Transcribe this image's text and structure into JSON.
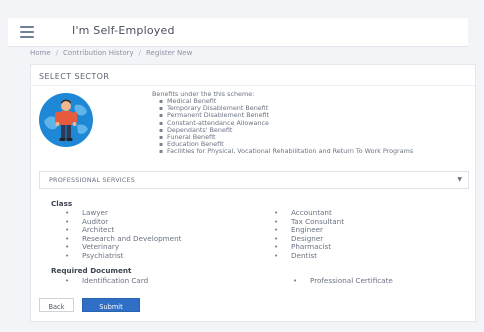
{
  "header": {
    "app_title": "I'm Self-Employed"
  },
  "breadcrumb": {
    "items": [
      "Home",
      "Contribution History",
      "Register New"
    ]
  },
  "card": {
    "title": "SELECT SECTOR",
    "benefits_heading": "Benefits under the this scheme:",
    "benefits": [
      "Medical Benefit",
      "Temporary Disablement Benefit",
      "Permanent Disablement Benefit",
      "Constant-attendance Allowance",
      "Dependants' Benefit",
      "Funeral Benefit",
      "Education Benefit",
      "Facilities for Physical, Vocational Rehabilitation and Return To Work Programs"
    ],
    "sector_select": {
      "selected": "PROFESSIONAL SERVICES"
    },
    "class_heading": "Class",
    "class_left": [
      "Lawyer",
      "Auditor",
      "Architect",
      "Research and Development",
      "Veterinary",
      "Psychiatrist"
    ],
    "class_right": [
      "Accountant",
      "Tax Consultant",
      "Engineer",
      "Designer",
      "Pharmacist",
      "Dentist"
    ],
    "required_heading": "Required Document",
    "required_docs": [
      "Identification Card",
      "Professional Certificate"
    ],
    "buttons": {
      "back": "Back",
      "submit": "Submit"
    }
  },
  "colors": {
    "accent": "#2f6fc5",
    "avatar_bg": "#1e88d6"
  },
  "icons": {
    "menu": "hamburger-icon",
    "select_arrow": "chevron-down-icon",
    "illustration": "worker-avatar-icon"
  }
}
